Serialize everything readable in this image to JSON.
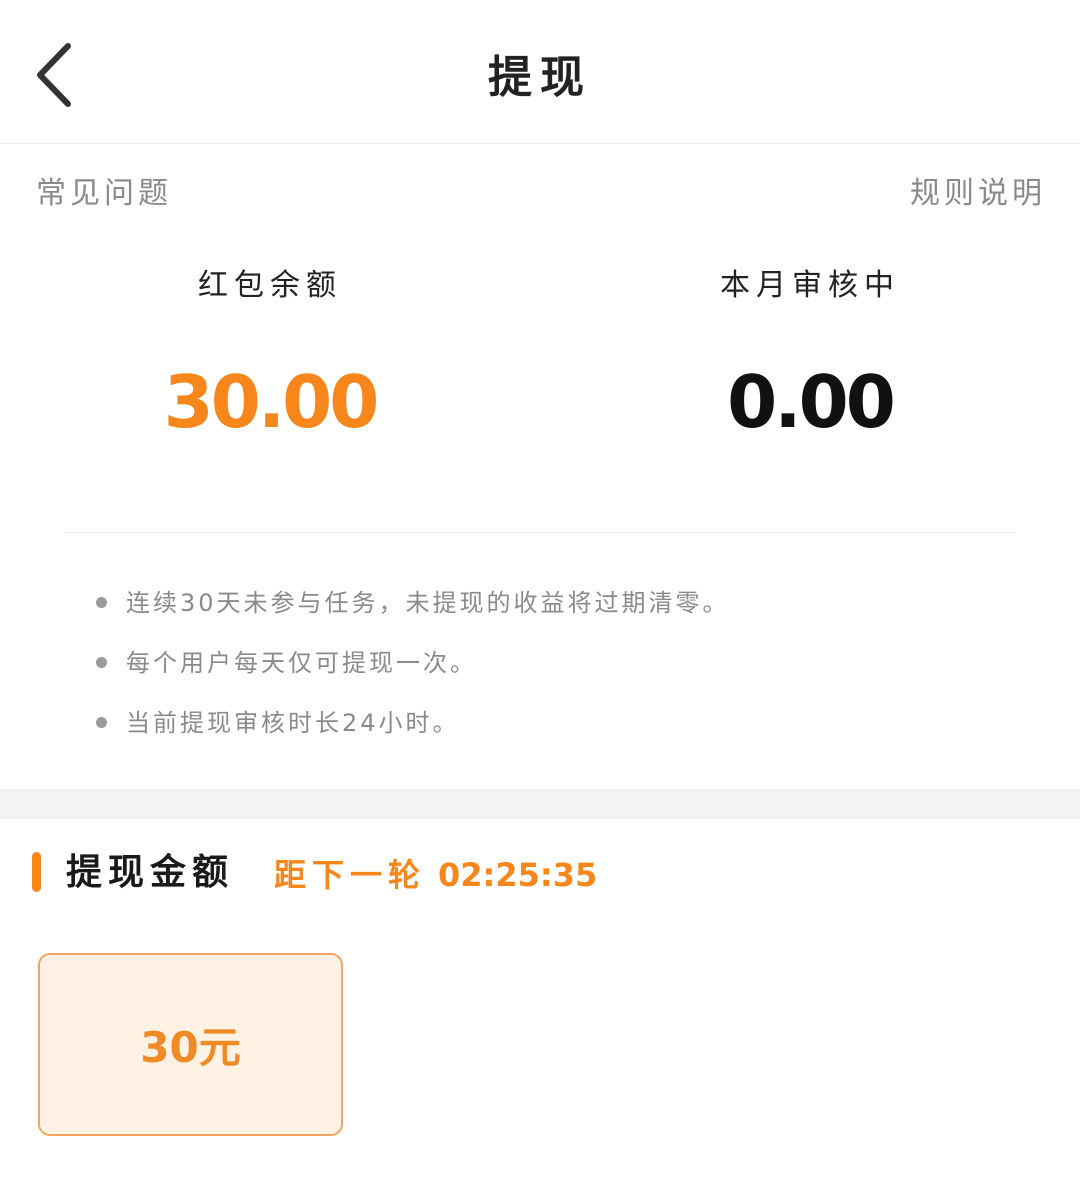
{
  "header": {
    "title": "提现",
    "back_icon": "chevron-left-icon"
  },
  "links": {
    "faq": "常见问题",
    "rules": "规则说明"
  },
  "stats": {
    "balance_label": "红包余额",
    "balance_value": "30.00",
    "review_label": "本月审核中",
    "review_value": "0.00"
  },
  "notes": [
    "连续30天未参与任务，未提现的收益将过期清零。",
    "每个用户每天仅可提现一次。",
    "当前提现审核时长24小时。"
  ],
  "withdraw": {
    "section_title": "提现金额",
    "countdown_label": "距下一轮",
    "countdown_time": "02:25:35",
    "options": [
      {
        "label": "30元",
        "selected": true
      }
    ]
  },
  "colors": {
    "accent": "#f7861b",
    "card_bg": "#fff1e3",
    "card_border": "#f3a55e",
    "muted_text": "#8a8a8a"
  }
}
